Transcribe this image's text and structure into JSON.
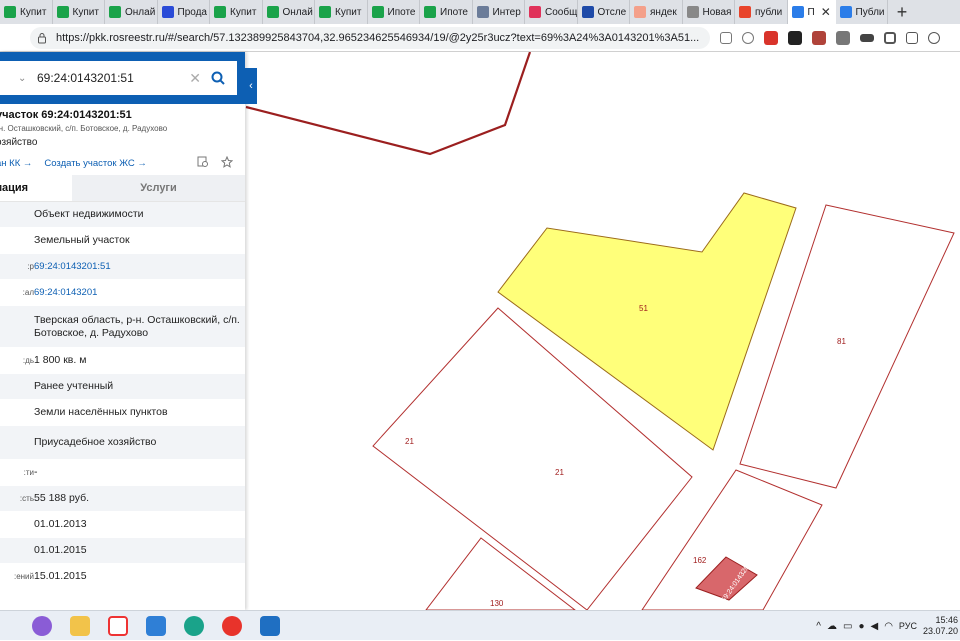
{
  "browser": {
    "tabs": [
      {
        "label": "Купит",
        "color": "#1aa34a"
      },
      {
        "label": "Купит",
        "color": "#1aa34a"
      },
      {
        "label": "Онлай",
        "color": "#1aa34a"
      },
      {
        "label": "Прода",
        "color": "#2a4bd7"
      },
      {
        "label": "Купит",
        "color": "#1aa34a"
      },
      {
        "label": "Онлай",
        "color": "#1aa34a"
      },
      {
        "label": "Купит",
        "color": "#1aa34a"
      },
      {
        "label": "Ипоте",
        "color": "#1aa34a"
      },
      {
        "label": "Ипоте",
        "color": "#1aa34a"
      },
      {
        "label": "Интер",
        "color": "#6b7c99"
      },
      {
        "label": "Сообщ",
        "color": "#e0325a"
      },
      {
        "label": "Отсле",
        "color": "#1e4aa8"
      },
      {
        "label": "яндек",
        "color": "#f4a08a"
      },
      {
        "label": "Новая",
        "color": "#888888"
      },
      {
        "label": "публи",
        "color": "#e8442b"
      },
      {
        "label": "П",
        "color": "#2b7de9",
        "active": true,
        "close": "✕"
      },
      {
        "label": "Публи",
        "color": "#2b7de9"
      }
    ],
    "new_tab": "+",
    "url": "https://pkk.rosreestr.ru/#/search/57.132389925843704,32.965234625546934/19/@2y25r3ucz?text=69%3A24%3A0143201%3A51..."
  },
  "panel": {
    "search_value": "69:24:0143201:51",
    "clear_glyph": "✕",
    "collapse_glyph": "‹",
    "title": "участок 69:24:0143201:51",
    "subtitle": "-н. Осташковский, с/п. Ботовское, д. Радухово",
    "type_line": "озяйство",
    "link1": "ан КК →",
    "link2": "Создать участок ЖС →",
    "tab_info": "мация",
    "tab_services": "Услуги",
    "rows": [
      {
        "k": "",
        "v": "Объект недвижимости"
      },
      {
        "k": "",
        "v": "Земельный участок"
      },
      {
        "k": "р:",
        "v": "69:24:0143201:51",
        "link": true
      },
      {
        "k": "ал:",
        "v": "69:24:0143201",
        "link": true
      },
      {
        "k": "",
        "v": "Тверская область, р-н. Осташковский, с/п. Ботовское, д. Радухово"
      },
      {
        "k": "дь:",
        "v": "1 800 кв. м"
      },
      {
        "k": "",
        "v": "Ранее учтенный"
      },
      {
        "k": "",
        "v": "Земли населённых пунктов"
      },
      {
        "k": "",
        "v": "Приусадебное хозяйство"
      },
      {
        "k": "ти:",
        "v": "-"
      },
      {
        "k": "сть:",
        "v": "55 188 руб."
      },
      {
        "k": "",
        "v": "01.01.2013"
      },
      {
        "k": "",
        "v": "01.01.2015"
      },
      {
        "k": "ений:",
        "v": "15.01.2015"
      }
    ]
  },
  "map": {
    "labels": {
      "p51": "51",
      "p81": "81",
      "p21a": "21",
      "p21b": "21",
      "p162": "162",
      "p130": "130",
      "bld": "69:24:0143201"
    },
    "highlight_color": "#ffff7a"
  },
  "taskbar": {
    "lang": "РУС",
    "time": "15:46",
    "date": "23.07.20",
    "up_glyph": "^"
  }
}
